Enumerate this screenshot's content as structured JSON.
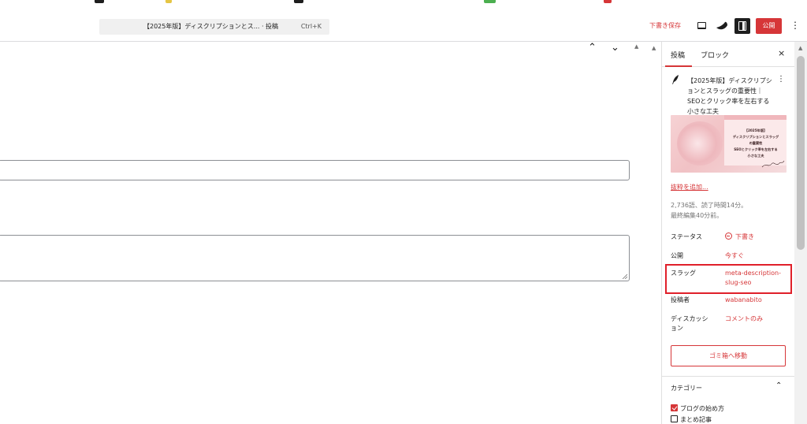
{
  "header": {
    "command_title": "【2025年版】ディスクリプションとス... · 投稿",
    "command_shortcut": "Ctrl+K",
    "save_draft_label": "下書き保存",
    "publish_label": "公開",
    "more_label": "⋮"
  },
  "editor": {
    "nav_up": "⌃",
    "nav_down": "⌄",
    "collapse": "▲"
  },
  "sidebar": {
    "tabs": [
      {
        "label": "投稿",
        "active": true
      },
      {
        "label": "ブロック",
        "active": false
      }
    ],
    "close_label": "×",
    "post": {
      "title": "【2025年版】ディスクリプションとスラッグの重要性｜SEOとクリック率を左右する小さな工夫",
      "menu": "⋮"
    },
    "thumbnail_text": [
      "【2025年版】",
      "ディスクリプションとスラッグ",
      "の重要性",
      "SEOとクリック率を左右する",
      "小さな工夫"
    ],
    "add_excerpt": "抜粋を追加...",
    "stats_line_1": "2,736語、読了時間14分。",
    "stats_line_2": "最終編集40分前。",
    "rows": {
      "status_label": "ステータス",
      "status_value": "下書き",
      "publish_label": "公開",
      "publish_value": "今すぐ",
      "slug_label": "スラッグ",
      "slug_value_1": "meta-description-",
      "slug_value_2": "slug-seo",
      "author_label": "投稿者",
      "author_value": "wabanabito",
      "discussion_label_1": "ディスカッシ",
      "discussion_label_2": "ョン",
      "discussion_value": "コメントのみ"
    },
    "trash_label": "ゴミ箱へ移動",
    "categories": {
      "title": "カテゴリー",
      "chevron": "⌃",
      "items": [
        {
          "label": "ブログの始め方",
          "checked": true
        },
        {
          "label": "まとめ記事",
          "checked": false
        }
      ]
    }
  },
  "scrollbar": {
    "up": "▲"
  },
  "colors": {
    "accent": "#d63638",
    "highlight": "#e0202a"
  }
}
